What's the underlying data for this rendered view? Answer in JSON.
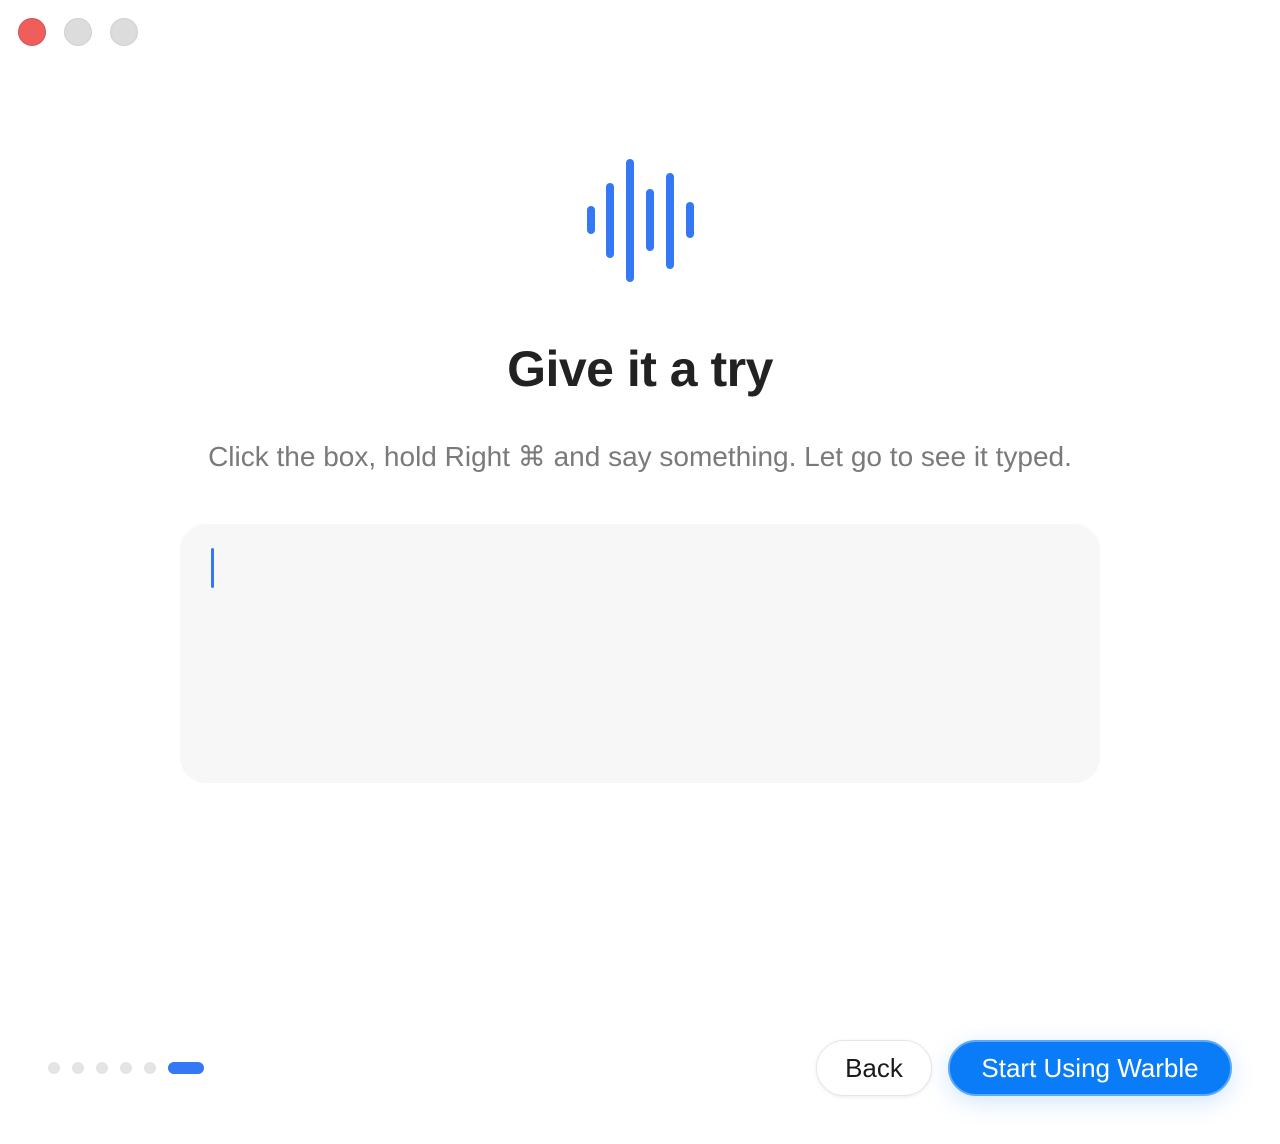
{
  "window": {
    "controls": [
      "close",
      "minimize",
      "maximize"
    ]
  },
  "hero": {
    "icon": "waveform-icon",
    "title": "Give it a try",
    "subtitle": "Click the box, hold Right ⌘ and say something. Let go to see it typed."
  },
  "try_box": {
    "value": "",
    "placeholder": ""
  },
  "pager": {
    "total_steps": 6,
    "current_step": 6
  },
  "footer": {
    "back_label": "Back",
    "start_label": "Start Using Warble"
  },
  "colors": {
    "accent": "#3478f6",
    "primary_button": "#0a7cf7",
    "title_text": "#222222",
    "subtitle_text": "#7a7a7a",
    "box_background": "#f7f7f7",
    "close_button": "#ee5f5b"
  }
}
